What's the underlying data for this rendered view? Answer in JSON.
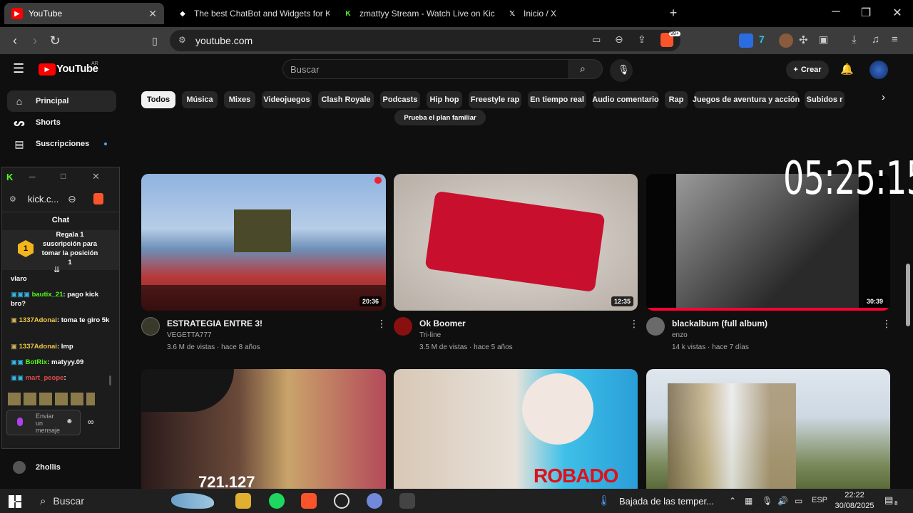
{
  "browser": {
    "tabs": [
      {
        "title": "YouTube",
        "active": true
      },
      {
        "title": "The best ChatBot and Widgets for Kic"
      },
      {
        "title": "zmattyy Stream - Watch Live on Kick"
      },
      {
        "title": "Inicio / X"
      }
    ],
    "url": "youtube.com",
    "shields_badge": "99+"
  },
  "youtube": {
    "logo_text": "YouTube",
    "logo_region": "AR",
    "search_placeholder": "Buscar",
    "create_label": "Crear",
    "sidebar": [
      {
        "label": "Principal",
        "selected": true
      },
      {
        "label": "Shorts"
      },
      {
        "label": "Suscripciones"
      }
    ],
    "sidebar_sub_visible": "2hollis",
    "chips": [
      "Todos",
      "Música",
      "Mixes",
      "Videojuegos",
      "Clash Royale",
      "Podcasts",
      "Hip hop",
      "Freestyle rap",
      "En tiempo real",
      "Audio comentario",
      "Rap",
      "Juegos de aventura y acción",
      "Subidos r"
    ],
    "banner_button": "Prueba el plan familiar",
    "videos": [
      {
        "title": "ESTRATEGIA ENTRE 3!",
        "channel": "VEGETTA777",
        "meta": "3.6 M de vistas · hace 8 años",
        "duration": "20:36"
      },
      {
        "title": "Ok Boomer",
        "channel": "Tri-line",
        "meta": "3.5 M de vistas · hace 5 años",
        "duration": "12:35"
      },
      {
        "title": "blackalbum (full album)",
        "channel": "enzo",
        "meta": "14 k vistas · hace 7 días",
        "duration": "30:39"
      }
    ],
    "row2_overlay": {
      "stream_count": "721.127",
      "robado_text": "ROBADO"
    }
  },
  "kick_popup": {
    "url": "kick.c...",
    "chat_title": "Chat",
    "pinned": {
      "rank": "1",
      "text": "Regala 1 suscripción para tomar la posición 1"
    },
    "messages": [
      {
        "user": "",
        "text": "vlaro"
      },
      {
        "user": "bautix_21",
        "text": "pago kick bro?"
      },
      {
        "user": "1337Adonai",
        "text": "toma te giro 5k"
      },
      {
        "user": "1337Adonai",
        "text": "lmp"
      },
      {
        "user": "BotRix",
        "text": "matyyy.09"
      },
      {
        "user": "mart_peope",
        "text": ""
      }
    ],
    "input_placeholder": "Enviar un mensaje"
  },
  "overlay_clock": "05:25:15",
  "taskbar": {
    "search_label": "Buscar",
    "weather_text": "Bajada de las temper...",
    "language": "ESP",
    "time": "22:22",
    "date": "30/08/2025",
    "notif_count": "8"
  },
  "colors": {
    "yt_red": "#ff0000",
    "kick_green": "#53fc18",
    "brave_orange": "#fb542b"
  }
}
